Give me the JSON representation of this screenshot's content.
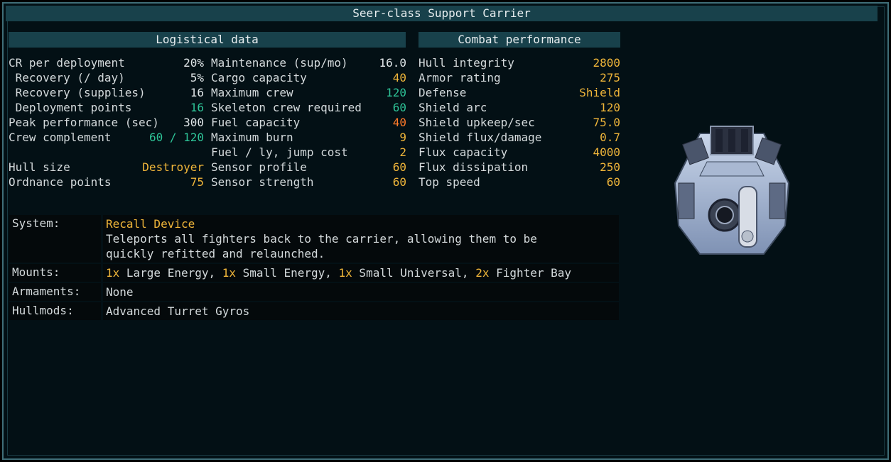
{
  "title": "Seer-class Support Carrier",
  "logistics": {
    "header": "Logistical data",
    "col1": [
      {
        "label": "CR per deployment",
        "value": "20%",
        "color": "w"
      },
      {
        "label": " Recovery (/ day)",
        "value": "5%",
        "color": "w"
      },
      {
        "label": " Recovery (supplies)",
        "value": "16",
        "color": "w"
      },
      {
        "label": " Deployment points",
        "value": "16",
        "color": "g"
      },
      {
        "label": "Peak performance (sec)",
        "value": "300",
        "color": "w"
      },
      {
        "label": "Crew complement",
        "value": "60 / 120",
        "color": "g"
      },
      {
        "label": "",
        "value": "",
        "color": "w"
      },
      {
        "label": "Hull size",
        "value": "Destroyer",
        "color": "y"
      },
      {
        "label": "Ordnance points",
        "value": "75",
        "color": "y"
      }
    ],
    "col2": [
      {
        "label": "Maintenance (sup/mo)",
        "value": "16.0",
        "color": "w"
      },
      {
        "label": "Cargo capacity",
        "value": "40",
        "color": "y"
      },
      {
        "label": "Maximum crew",
        "value": "120",
        "color": "g"
      },
      {
        "label": "Skeleton crew required",
        "value": "60",
        "color": "g"
      },
      {
        "label": "Fuel capacity",
        "value": "40",
        "color": "o"
      },
      {
        "label": "Maximum burn",
        "value": "9",
        "color": "y"
      },
      {
        "label": "Fuel / ly, jump cost",
        "value": "2",
        "color": "y"
      },
      {
        "label": "Sensor profile",
        "value": "60",
        "color": "y"
      },
      {
        "label": "Sensor strength",
        "value": "60",
        "color": "y"
      }
    ]
  },
  "combat": {
    "header": "Combat performance",
    "rows": [
      {
        "label": "Hull integrity",
        "value": "2800",
        "color": "y"
      },
      {
        "label": "Armor rating",
        "value": "275",
        "color": "y"
      },
      {
        "label": "Defense",
        "value": "Shield",
        "color": "y"
      },
      {
        "label": "Shield arc",
        "value": "120",
        "color": "y"
      },
      {
        "label": "Shield upkeep/sec",
        "value": "75.0",
        "color": "y"
      },
      {
        "label": "Shield flux/damage",
        "value": "0.7",
        "color": "y"
      },
      {
        "label": "Flux capacity",
        "value": "4000",
        "color": "y"
      },
      {
        "label": "Flux dissipation",
        "value": "250",
        "color": "y"
      },
      {
        "label": "Top speed",
        "value": "60",
        "color": "y"
      }
    ]
  },
  "info": {
    "system_label": "System:",
    "system_name": "Recall Device",
    "system_desc": "Teleports all fighters back to the carrier, allowing them to be quickly refitted and relaunched.",
    "mounts_label": "Mounts:",
    "mounts": [
      {
        "count": "1x",
        "name": " Large Energy, "
      },
      {
        "count": "1x",
        "name": " Small Energy, "
      },
      {
        "count": "1x",
        "name": " Small Universal, "
      },
      {
        "count": "2x",
        "name": " Fighter Bay"
      }
    ],
    "armaments_label": "Armaments:",
    "armaments_value": "None",
    "hullmods_label": "Hullmods:",
    "hullmods_value": "Advanced Turret Gyros"
  },
  "colors": {
    "accent_yellow": "#f0b63a",
    "accent_green": "#2ec397",
    "accent_orange": "#ff7a2a",
    "header_bg": "#18414b"
  },
  "ship_icon": "seer-carrier-ship-sprite"
}
